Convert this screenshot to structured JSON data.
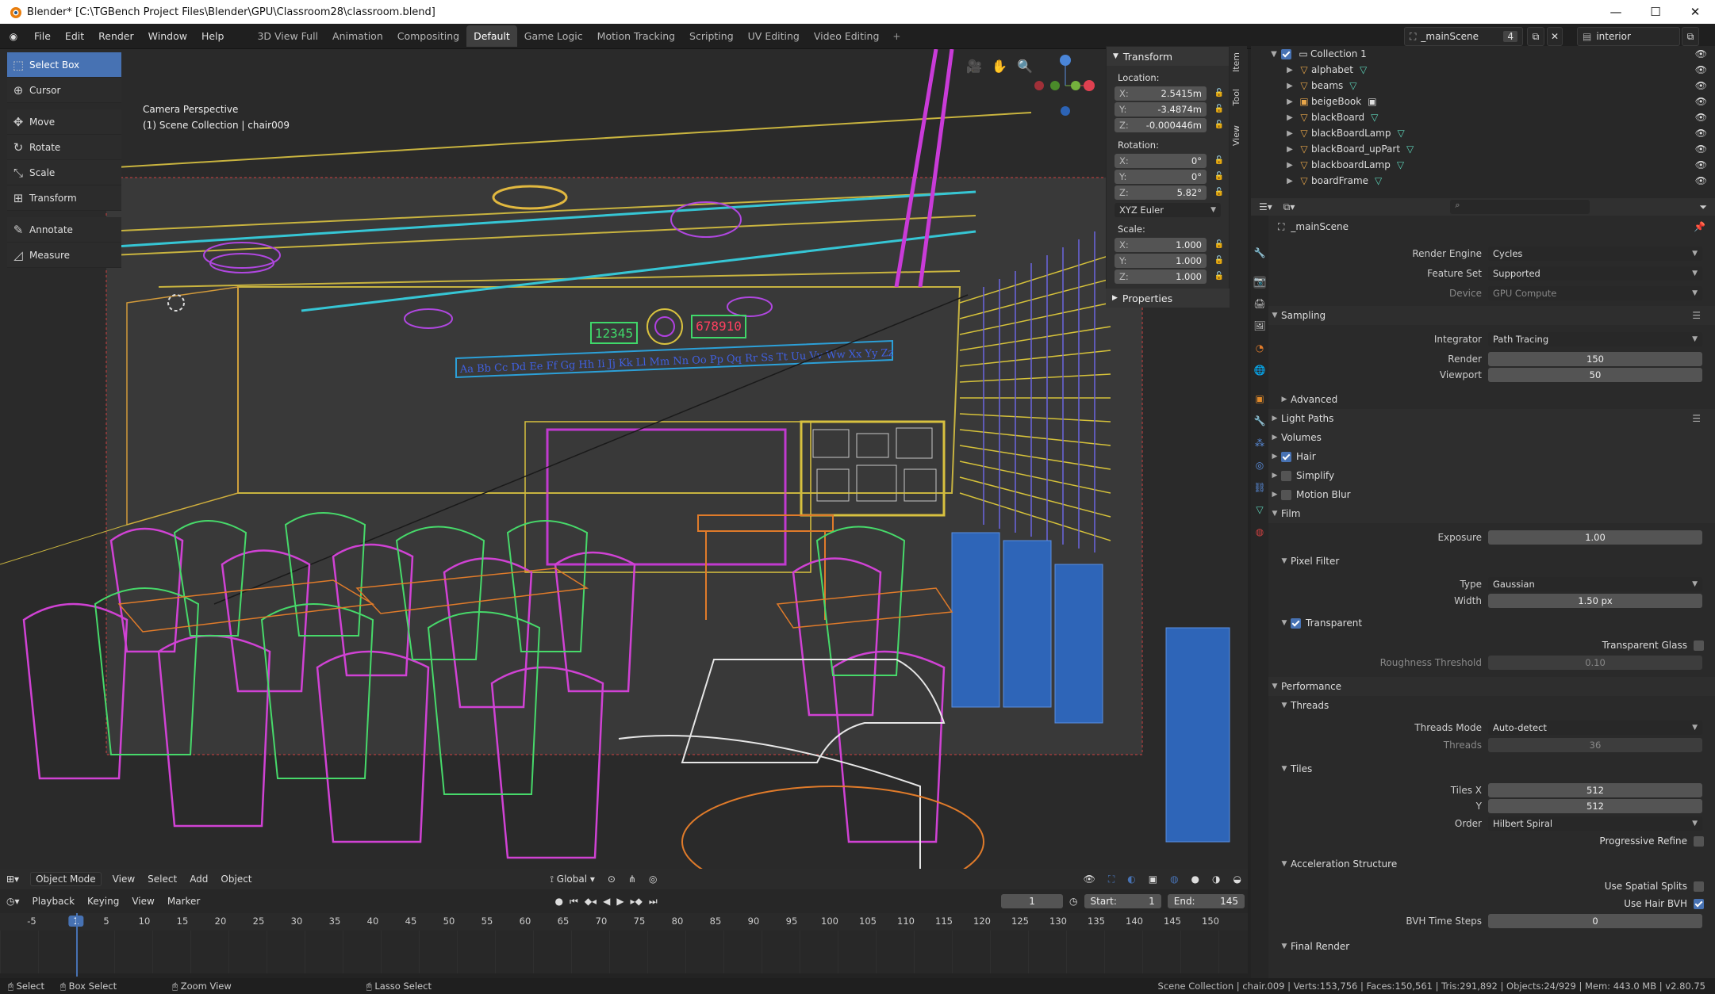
{
  "window": {
    "title": "Blender* [C:\\TGBench Project Files\\Blender\\GPU\\Classroom28\\classroom.blend]",
    "min": "—",
    "max": "☐",
    "close": "✕"
  },
  "menu": [
    "File",
    "Edit",
    "Render",
    "Window",
    "Help"
  ],
  "workspaces": [
    "3D View Full",
    "Animation",
    "Compositing",
    "Default",
    "Game Logic",
    "Motion Tracking",
    "Scripting",
    "UV Editing",
    "Video Editing"
  ],
  "active_workspace": "Default",
  "scene": {
    "name": "_mainScene",
    "users": "4",
    "view_layer": "interior"
  },
  "tools": [
    {
      "label": "Select Box",
      "icon": "select-box-icon",
      "glyph": "⬚"
    },
    {
      "label": "Cursor",
      "icon": "cursor-icon",
      "glyph": "⊕"
    },
    {
      "label": "Move",
      "icon": "move-icon",
      "glyph": "✥"
    },
    {
      "label": "Rotate",
      "icon": "rotate-icon",
      "glyph": "↻"
    },
    {
      "label": "Scale",
      "icon": "scale-icon",
      "glyph": "⤡"
    },
    {
      "label": "Transform",
      "icon": "transform-icon",
      "glyph": "⊞"
    },
    {
      "label": "Annotate",
      "icon": "annotate-icon",
      "glyph": "✎"
    },
    {
      "label": "Measure",
      "icon": "measure-icon",
      "glyph": "📐"
    }
  ],
  "viewport": {
    "mode_label": "Camera Perspective",
    "collection_label": "(1) Scene Collection | chair009"
  },
  "transform": {
    "title": "Transform",
    "location_label": "Location:",
    "location": [
      {
        "k": "X:",
        "v": "2.5415m"
      },
      {
        "k": "Y:",
        "v": "-3.4874m"
      },
      {
        "k": "Z:",
        "v": "-0.000446m"
      }
    ],
    "rotation_label": "Rotation:",
    "rotation": [
      {
        "k": "X:",
        "v": "0°"
      },
      {
        "k": "Y:",
        "v": "0°"
      },
      {
        "k": "Z:",
        "v": "5.82°"
      }
    ],
    "rotation_mode": "XYZ Euler",
    "scale_label": "Scale:",
    "scale": [
      {
        "k": "X:",
        "v": "1.000"
      },
      {
        "k": "Y:",
        "v": "1.000"
      },
      {
        "k": "Z:",
        "v": "1.000"
      }
    ],
    "properties_title": "Properties"
  },
  "sidebar_tabs": [
    "Item",
    "Tool",
    "View"
  ],
  "header": {
    "mode": "Object Mode",
    "view": "View",
    "select": "Select",
    "add": "Add",
    "object": "Object",
    "orientation": "Global"
  },
  "timeline": {
    "playback": "Playback",
    "keying": "Keying",
    "view": "View",
    "marker": "Marker",
    "current": "1",
    "start_label": "Start:",
    "start": "1",
    "end_label": "End:",
    "end": "145",
    "ruler": [
      "-5",
      "1",
      "5",
      "10",
      "15",
      "20",
      "25",
      "30",
      "35",
      "40",
      "45",
      "50",
      "55",
      "60",
      "65",
      "70",
      "75",
      "80",
      "85",
      "90",
      "95",
      "100",
      "105",
      "110",
      "115",
      "120",
      "125",
      "130",
      "135",
      "140",
      "145",
      "150"
    ]
  },
  "status": {
    "select": "Select",
    "box_select": "Box Select",
    "zoom": "Zoom View",
    "lasso": "Lasso Select",
    "stats": "Scene Collection | chair.009 | Verts:153,756 | Faces:150,561 | Tris:291,892 | Objects:24/929 | Mem: 443.0 MB | v2.80.75"
  },
  "outliner": {
    "collection": "Collection 1",
    "items": [
      {
        "name": "alphabet",
        "tag": "▽"
      },
      {
        "name": "beams",
        "tag": "▽"
      },
      {
        "name": "beigeBook",
        "tag": "▣"
      },
      {
        "name": "blackBoard",
        "tag": "▽"
      },
      {
        "name": "blackBoardLamp",
        "tag": "▽"
      },
      {
        "name": "blackBoard_upPart",
        "tag": "▽"
      },
      {
        "name": "blackboardLamp",
        "tag": "▽"
      },
      {
        "name": "boardFrame",
        "tag": "▽"
      }
    ]
  },
  "props": {
    "scene_name": "_mainScene",
    "render_engine_label": "Render Engine",
    "render_engine": "Cycles",
    "feature_set_label": "Feature Set",
    "feature_set": "Supported",
    "device_label": "Device",
    "device": "GPU Compute",
    "sampling": "Sampling",
    "integrator_label": "Integrator",
    "integrator": "Path Tracing",
    "render_label": "Render",
    "render": "150",
    "viewport_label": "Viewport",
    "viewport": "50",
    "advanced": "Advanced",
    "light_paths": "Light Paths",
    "volumes": "Volumes",
    "hair": "Hair",
    "simplify": "Simplify",
    "motion_blur": "Motion Blur",
    "film": "Film",
    "exposure_label": "Exposure",
    "exposure": "1.00",
    "pixel_filter": "Pixel Filter",
    "type_label": "Type",
    "type": "Gaussian",
    "width_label": "Width",
    "width": "1.50 px",
    "transparent": "Transparent",
    "transparent_glass": "Transparent Glass",
    "roughness_label": "Roughness Threshold",
    "roughness": "0.10",
    "performance": "Performance",
    "threads": "Threads",
    "threads_mode_label": "Threads Mode",
    "threads_mode": "Auto-detect",
    "threads_label": "Threads",
    "threads_value": "36",
    "tiles": "Tiles",
    "tiles_x_label": "Tiles X",
    "tiles_x": "512",
    "tiles_y_label": "Y",
    "tiles_y": "512",
    "order_label": "Order",
    "order": "Hilbert Spiral",
    "progressive_refine": "Progressive Refine",
    "accel": "Acceleration Structure",
    "spatial_splits": "Use Spatial Splits",
    "hair_bvh": "Use Hair BVH",
    "bvh_steps_label": "BVH Time Steps",
    "bvh_steps": "0",
    "final_render": "Final Render"
  },
  "wall_numbers": [
    "12345",
    "678910"
  ],
  "alphabet_strip": "Aa Bb Cc Dd Ee Ff Gg Hh Ii Jj Kk Ll Mm Nn Oo Pp Qq Rr Ss Tt Uu Vv Ww Xx Yy Zz"
}
